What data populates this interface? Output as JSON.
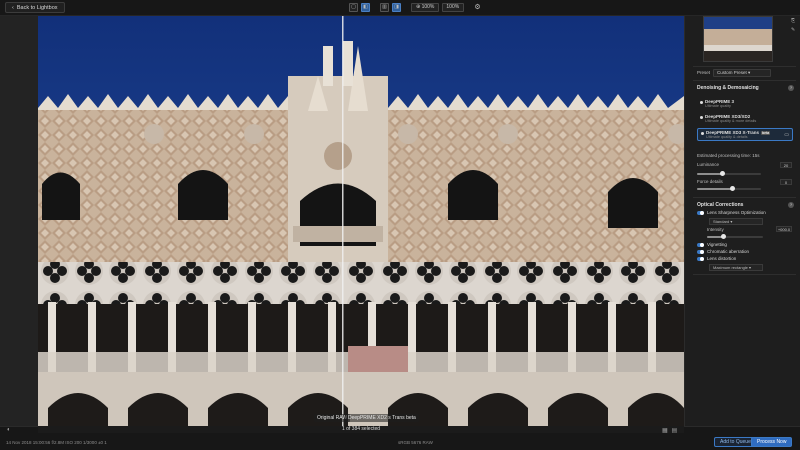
{
  "topbar": {
    "back_label": "Back to Lightbox",
    "zoom": "100%",
    "zoom_select": "100%"
  },
  "photo": {
    "left_label": "Original RAW",
    "right_label": "DeepPRIME XD2 s Trans beta"
  },
  "panel": {
    "preset_label": "Preset",
    "preset_value": "Custom Preset",
    "denoise_title": "Denoising & Demosaicing",
    "options": [
      {
        "title": "DeepPRIME 3",
        "sub": "Ultimate quality",
        "badge": ""
      },
      {
        "title": "DeepPRIME XD3/XD2",
        "sub": "Ultimate quality & more details",
        "badge": ""
      },
      {
        "title": "DeepPRIME XD3 X-Trans",
        "sub": "Ultimate quality & details",
        "badge": "beta"
      }
    ],
    "sensor_note": "Estimated processing time: 15s",
    "luminance_label": "Luminance",
    "luminance_value": "20",
    "luminance_level": 0.4,
    "force_label": "Force details",
    "force_value": "0",
    "force_level": 0.55,
    "optical_title": "Optical Corrections",
    "lens_opt_label": "Lens Sharpness Optimization",
    "lens_opt_select": "Standard",
    "intensity_label": "Intensity",
    "intensity_value": "+000.0",
    "intensity_level": 0.3,
    "vignetting_label": "Vignetting",
    "chromatic_label": "Chromatic aberration",
    "distortion_label": "Lens distortion",
    "distortion_select": "Maximum rectangle"
  },
  "bottom": {
    "count": "1 of 384 selected",
    "info_left": "14 Nov 2018 15:00:56   f/2.8M   ISO 200   1/3000   ±0 1",
    "info_center": "sRGB 5676 RAW",
    "add_queue": "Add to Queue",
    "process_now": "Process Now"
  }
}
